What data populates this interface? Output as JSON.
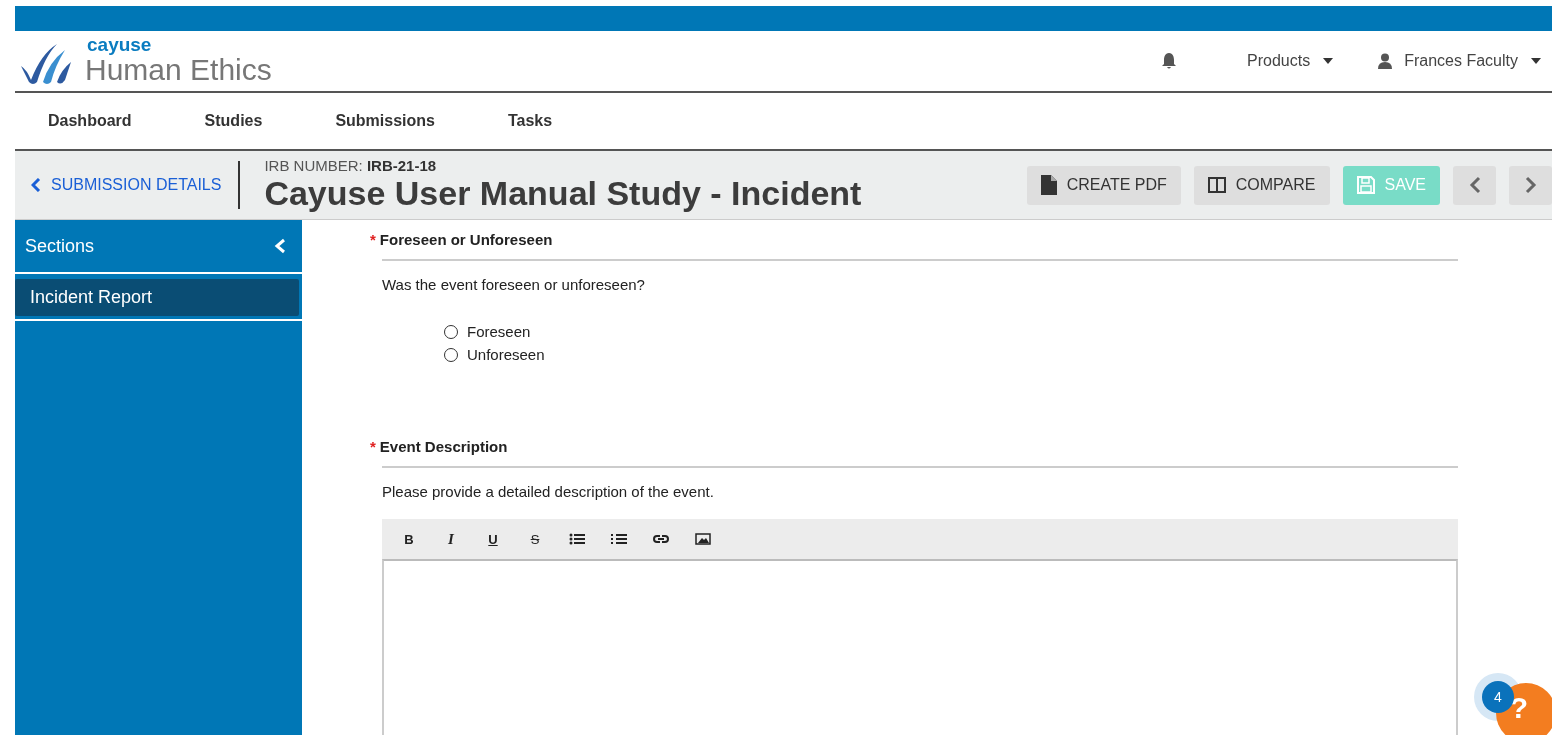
{
  "brand": {
    "small": "cayuse",
    "large": "Human Ethics"
  },
  "header": {
    "products": "Products",
    "user": "Frances Faculty"
  },
  "nav": [
    {
      "label": "Dashboard",
      "selected": false
    },
    {
      "label": "Studies",
      "selected": false
    },
    {
      "label": "Submissions",
      "selected": false
    },
    {
      "label": "Tasks",
      "selected": false
    }
  ],
  "titlebar": {
    "back": "SUBMISSION DETAILS",
    "irb_label": "IRB NUMBER:",
    "irb_value": "IRB-21-18",
    "title": "Cayuse User Manual Study - Incident",
    "buttons": [
      {
        "kind": "pdf",
        "label": "CREATE PDF"
      },
      {
        "kind": "compare",
        "label": "COMPARE"
      },
      {
        "kind": "save",
        "label": "SAVE",
        "disabled": true
      }
    ]
  },
  "sidebar": {
    "title": "Sections",
    "items": [
      {
        "label": "Incident Report",
        "selected": true
      }
    ]
  },
  "questions": [
    {
      "title": "Foreseen or Unforeseen",
      "required_mark": "*",
      "prompt": "Was the event foreseen or unforeseen?",
      "kind": "radio",
      "options": [
        {
          "label": "Foreseen",
          "selected": false
        },
        {
          "label": "Unforeseen",
          "selected": false
        }
      ]
    },
    {
      "title": "Event Description",
      "required_mark": "*",
      "prompt": "Please provide a detailed description of the event.",
      "kind": "editor",
      "toolbar": [
        {
          "kind": "bold",
          "text": "B"
        },
        {
          "kind": "italic",
          "text": "I"
        },
        {
          "kind": "underline",
          "text": "U"
        },
        {
          "kind": "strike",
          "text": "S"
        },
        {
          "kind": "bullets"
        },
        {
          "kind": "numbers"
        },
        {
          "kind": "link"
        },
        {
          "kind": "image"
        }
      ]
    }
  ],
  "help": {
    "badge": "4",
    "mark": "?"
  }
}
